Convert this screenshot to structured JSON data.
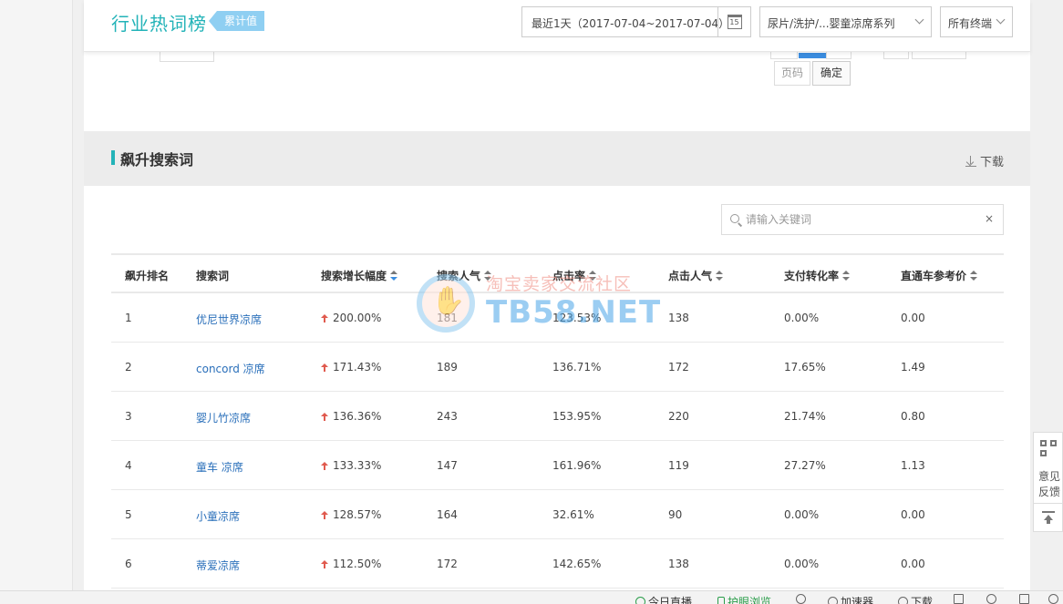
{
  "header": {
    "title": "行业热词榜",
    "badge": "累计值",
    "date_range": "最近1天（2017-07-04~2017-07-04）",
    "calendar_day": "15",
    "category": "尿片/洗护/...婴童凉席系列",
    "terminal": "所有终端"
  },
  "pager": {
    "page_placeholder": "页码",
    "confirm": "确定"
  },
  "section": {
    "title": "飙升搜索词",
    "download": "下载"
  },
  "search": {
    "placeholder": "请输入关键词",
    "clear": "×"
  },
  "table": {
    "columns": [
      "飙升排名",
      "搜索词",
      "搜索增长幅度",
      "搜索人气",
      "点击率",
      "点击人气",
      "支付转化率",
      "直通车参考价"
    ],
    "rows": [
      {
        "rank": "1",
        "keyword": "优尼世界凉席",
        "growth": "200.00%",
        "popularity": "181",
        "ctr": "123.53%",
        "click_pop": "138",
        "conv": "0.00%",
        "price": "0.00"
      },
      {
        "rank": "2",
        "keyword": "concord 凉席",
        "growth": "171.43%",
        "popularity": "189",
        "ctr": "136.71%",
        "click_pop": "172",
        "conv": "17.65%",
        "price": "1.49"
      },
      {
        "rank": "3",
        "keyword": "婴儿竹凉席",
        "growth": "136.36%",
        "popularity": "243",
        "ctr": "153.95%",
        "click_pop": "220",
        "conv": "21.74%",
        "price": "0.80"
      },
      {
        "rank": "4",
        "keyword": "童车 凉席",
        "growth": "133.33%",
        "popularity": "147",
        "ctr": "161.96%",
        "click_pop": "119",
        "conv": "27.27%",
        "price": "1.13"
      },
      {
        "rank": "5",
        "keyword": "小童凉席",
        "growth": "128.57%",
        "popularity": "164",
        "ctr": "32.61%",
        "click_pop": "90",
        "conv": "0.00%",
        "price": "0.00"
      },
      {
        "rank": "6",
        "keyword": "蒂爱凉席",
        "growth": "112.50%",
        "popularity": "172",
        "ctr": "142.65%",
        "click_pop": "138",
        "conv": "0.00%",
        "price": "0.00"
      }
    ]
  },
  "watermark": {
    "cn": "淘宝卖家交流社区",
    "en": "TB58.NET"
  },
  "float_panel": {
    "feedback": "意见反馈"
  },
  "status_bar": {
    "live": "今日直播",
    "eye_care": "护眼浏览",
    "accelerator": "加速器",
    "download": "下载"
  },
  "colors": {
    "accent": "#23b3b8",
    "badge": "#8fcff2",
    "link": "#2a6fba",
    "up": "#e05a4e",
    "active_sort": "#3b8de0"
  }
}
